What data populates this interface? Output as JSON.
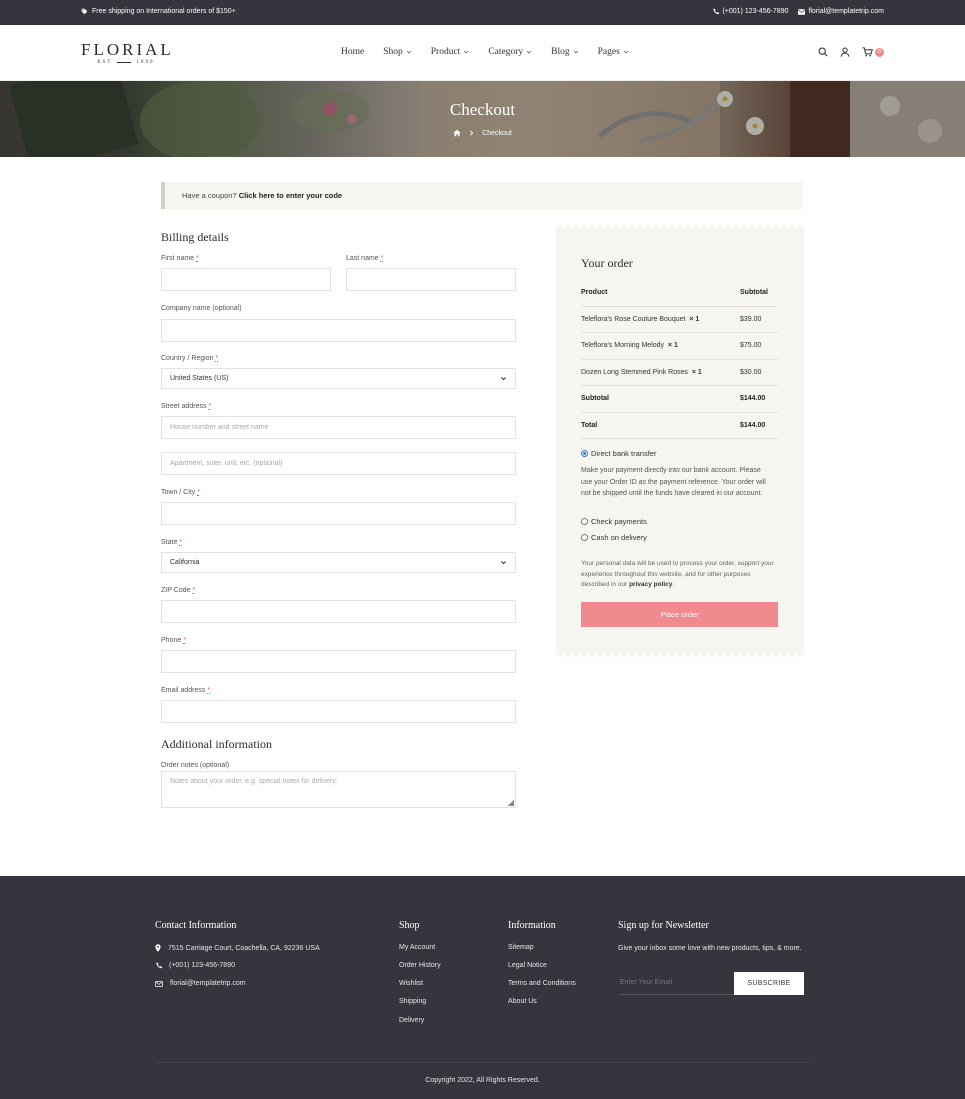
{
  "topbar": {
    "shipping": "Free shipping on International orders of $150+",
    "phone": "(+001) 123-456-7890",
    "email": "florial@templatetrip.com"
  },
  "header": {
    "logo_name": "FLORIAL",
    "logo_est": "EST",
    "logo_year": "1890",
    "nav": [
      {
        "label": "Home",
        "dropdown": false
      },
      {
        "label": "Shop",
        "dropdown": true
      },
      {
        "label": "Product",
        "dropdown": true
      },
      {
        "label": "Category",
        "dropdown": true
      },
      {
        "label": "Blog",
        "dropdown": true
      },
      {
        "label": "Pages",
        "dropdown": true
      }
    ],
    "cart_count": "0"
  },
  "hero": {
    "title": "Checkout",
    "crumb_current": "Checkout"
  },
  "coupon": {
    "text": "Have a coupon?",
    "link": "Click here to enter your code"
  },
  "billing": {
    "title": "Billing details",
    "first_name": "First name",
    "last_name": "Last name",
    "company": "Company name (optional)",
    "country_label": "Country / Region",
    "country_value": "United States (US)",
    "street_label": "Street address",
    "street_ph": "House number and street name",
    "street2_ph": "Apartment, suite, unit, etc. (optional)",
    "city": "Town / City",
    "state_label": "State",
    "state_value": "California",
    "zip": "ZIP Code",
    "phone": "Phone",
    "email": "Email address",
    "req": "*"
  },
  "additional": {
    "title": "Additional information",
    "notes_label": "Order notes (optional)",
    "notes_ph": "Notes about your order, e.g. special notes for delivery."
  },
  "order": {
    "title": "Your order",
    "col_product": "Product",
    "col_subtotal": "Subtotal",
    "items": [
      {
        "name": "Teleflora's Rose Couture Bouquet",
        "qty": "× 1",
        "price": "$39.00"
      },
      {
        "name": "Teleflora's Morning Melody",
        "qty": "× 1",
        "price": "$75.00"
      },
      {
        "name": "Dozen Long Stemmed Pink Roses",
        "qty": "× 1",
        "price": "$30.00"
      }
    ],
    "subtotal_label": "Subtotal",
    "subtotal_value": "$144.00",
    "total_label": "Total",
    "total_value": "$144.00",
    "payment": {
      "bank": "Direct bank transfer",
      "bank_desc": "Make your payment directly into our bank account. Please use your Order ID as the payment reference. Your order will not be shipped until the funds have cleared in our account.",
      "check": "Check payments",
      "cod": "Cash on delivery"
    },
    "privacy_text": "Your personal data will be used to process your order, support your experience throughout this website, and for other purposes described in our",
    "privacy_link": "privacy policy",
    "privacy_end": ".",
    "place_order": "Place order",
    "colors": {
      "accent": "#f08a8f",
      "panel": "#f6f5f0"
    }
  },
  "footer": {
    "contact_title": "Contact Information",
    "address": "7515 Carriage Court, Coachella, CA, 92236 USA",
    "phone": "(+001) 123-456-7890",
    "email": "florial@templatetrip.com",
    "shop_title": "Shop",
    "shop_links": [
      "My Account",
      "Order History",
      "Wishlist",
      "Shipping",
      "Delivery"
    ],
    "info_title": "Information",
    "info_links": [
      "Sitemap",
      "Legal Notice",
      "Terms and Conditions",
      "About Us"
    ],
    "newsletter_title": "Sign up for Newsletter",
    "newsletter_desc": "Give your inbox some love with new products, tips, & more.",
    "newsletter_ph": "Enter Your Email",
    "subscribe": "SUBSCRIBE",
    "copyright": "Copyright 2022, All Rights Reserved.",
    "bg": "#35363d"
  }
}
